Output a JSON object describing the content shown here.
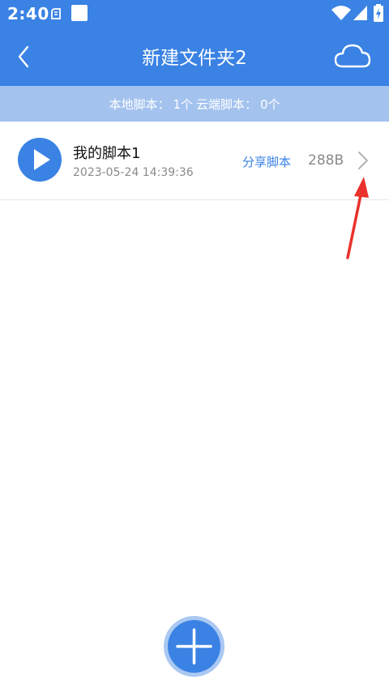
{
  "status_bar": {
    "time": "2:40",
    "icons": [
      "notification-icon",
      "app-square-icon",
      "wifi-icon",
      "signal-icon",
      "battery-charging-icon"
    ]
  },
  "app_bar": {
    "title": "新建文件夹2",
    "left_icon": "back-arrow-icon",
    "right_icon": "cloud-icon"
  },
  "summary": {
    "local_label": "本地脚本：",
    "local_count": "1个",
    "cloud_label": "云端脚本：",
    "cloud_count": "0个"
  },
  "scripts": [
    {
      "name": "我的脚本1",
      "date": "2023-05-24 14:39:36",
      "share_label": "分享脚本",
      "size": "288B",
      "icon": "play-icon"
    }
  ],
  "fab": {
    "icon": "plus-icon"
  },
  "colors": {
    "primary": "#3a82e4",
    "summary_bg": "#a3c2ee",
    "annotation": "#e8322b",
    "secondary_text": "#8a8a8a"
  }
}
